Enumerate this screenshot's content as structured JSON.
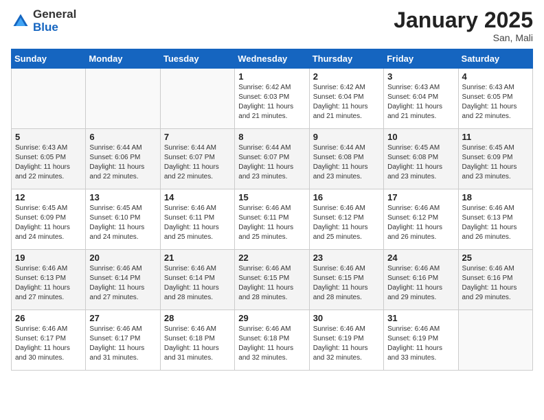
{
  "header": {
    "logo_general": "General",
    "logo_blue": "Blue",
    "month_title": "January 2025",
    "location": "San, Mali"
  },
  "days_of_week": [
    "Sunday",
    "Monday",
    "Tuesday",
    "Wednesday",
    "Thursday",
    "Friday",
    "Saturday"
  ],
  "weeks": [
    [
      {
        "day": "",
        "sunrise": "",
        "sunset": "",
        "daylight": "",
        "empty": true
      },
      {
        "day": "",
        "sunrise": "",
        "sunset": "",
        "daylight": "",
        "empty": true
      },
      {
        "day": "",
        "sunrise": "",
        "sunset": "",
        "daylight": "",
        "empty": true
      },
      {
        "day": "1",
        "sunrise": "Sunrise: 6:42 AM",
        "sunset": "Sunset: 6:03 PM",
        "daylight": "Daylight: 11 hours and 21 minutes.",
        "empty": false
      },
      {
        "day": "2",
        "sunrise": "Sunrise: 6:42 AM",
        "sunset": "Sunset: 6:04 PM",
        "daylight": "Daylight: 11 hours and 21 minutes.",
        "empty": false
      },
      {
        "day": "3",
        "sunrise": "Sunrise: 6:43 AM",
        "sunset": "Sunset: 6:04 PM",
        "daylight": "Daylight: 11 hours and 21 minutes.",
        "empty": false
      },
      {
        "day": "4",
        "sunrise": "Sunrise: 6:43 AM",
        "sunset": "Sunset: 6:05 PM",
        "daylight": "Daylight: 11 hours and 22 minutes.",
        "empty": false
      }
    ],
    [
      {
        "day": "5",
        "sunrise": "Sunrise: 6:43 AM",
        "sunset": "Sunset: 6:05 PM",
        "daylight": "Daylight: 11 hours and 22 minutes.",
        "empty": false
      },
      {
        "day": "6",
        "sunrise": "Sunrise: 6:44 AM",
        "sunset": "Sunset: 6:06 PM",
        "daylight": "Daylight: 11 hours and 22 minutes.",
        "empty": false
      },
      {
        "day": "7",
        "sunrise": "Sunrise: 6:44 AM",
        "sunset": "Sunset: 6:07 PM",
        "daylight": "Daylight: 11 hours and 22 minutes.",
        "empty": false
      },
      {
        "day": "8",
        "sunrise": "Sunrise: 6:44 AM",
        "sunset": "Sunset: 6:07 PM",
        "daylight": "Daylight: 11 hours and 23 minutes.",
        "empty": false
      },
      {
        "day": "9",
        "sunrise": "Sunrise: 6:44 AM",
        "sunset": "Sunset: 6:08 PM",
        "daylight": "Daylight: 11 hours and 23 minutes.",
        "empty": false
      },
      {
        "day": "10",
        "sunrise": "Sunrise: 6:45 AM",
        "sunset": "Sunset: 6:08 PM",
        "daylight": "Daylight: 11 hours and 23 minutes.",
        "empty": false
      },
      {
        "day": "11",
        "sunrise": "Sunrise: 6:45 AM",
        "sunset": "Sunset: 6:09 PM",
        "daylight": "Daylight: 11 hours and 23 minutes.",
        "empty": false
      }
    ],
    [
      {
        "day": "12",
        "sunrise": "Sunrise: 6:45 AM",
        "sunset": "Sunset: 6:09 PM",
        "daylight": "Daylight: 11 hours and 24 minutes.",
        "empty": false
      },
      {
        "day": "13",
        "sunrise": "Sunrise: 6:45 AM",
        "sunset": "Sunset: 6:10 PM",
        "daylight": "Daylight: 11 hours and 24 minutes.",
        "empty": false
      },
      {
        "day": "14",
        "sunrise": "Sunrise: 6:46 AM",
        "sunset": "Sunset: 6:11 PM",
        "daylight": "Daylight: 11 hours and 25 minutes.",
        "empty": false
      },
      {
        "day": "15",
        "sunrise": "Sunrise: 6:46 AM",
        "sunset": "Sunset: 6:11 PM",
        "daylight": "Daylight: 11 hours and 25 minutes.",
        "empty": false
      },
      {
        "day": "16",
        "sunrise": "Sunrise: 6:46 AM",
        "sunset": "Sunset: 6:12 PM",
        "daylight": "Daylight: 11 hours and 25 minutes.",
        "empty": false
      },
      {
        "day": "17",
        "sunrise": "Sunrise: 6:46 AM",
        "sunset": "Sunset: 6:12 PM",
        "daylight": "Daylight: 11 hours and 26 minutes.",
        "empty": false
      },
      {
        "day": "18",
        "sunrise": "Sunrise: 6:46 AM",
        "sunset": "Sunset: 6:13 PM",
        "daylight": "Daylight: 11 hours and 26 minutes.",
        "empty": false
      }
    ],
    [
      {
        "day": "19",
        "sunrise": "Sunrise: 6:46 AM",
        "sunset": "Sunset: 6:13 PM",
        "daylight": "Daylight: 11 hours and 27 minutes.",
        "empty": false
      },
      {
        "day": "20",
        "sunrise": "Sunrise: 6:46 AM",
        "sunset": "Sunset: 6:14 PM",
        "daylight": "Daylight: 11 hours and 27 minutes.",
        "empty": false
      },
      {
        "day": "21",
        "sunrise": "Sunrise: 6:46 AM",
        "sunset": "Sunset: 6:14 PM",
        "daylight": "Daylight: 11 hours and 28 minutes.",
        "empty": false
      },
      {
        "day": "22",
        "sunrise": "Sunrise: 6:46 AM",
        "sunset": "Sunset: 6:15 PM",
        "daylight": "Daylight: 11 hours and 28 minutes.",
        "empty": false
      },
      {
        "day": "23",
        "sunrise": "Sunrise: 6:46 AM",
        "sunset": "Sunset: 6:15 PM",
        "daylight": "Daylight: 11 hours and 28 minutes.",
        "empty": false
      },
      {
        "day": "24",
        "sunrise": "Sunrise: 6:46 AM",
        "sunset": "Sunset: 6:16 PM",
        "daylight": "Daylight: 11 hours and 29 minutes.",
        "empty": false
      },
      {
        "day": "25",
        "sunrise": "Sunrise: 6:46 AM",
        "sunset": "Sunset: 6:16 PM",
        "daylight": "Daylight: 11 hours and 29 minutes.",
        "empty": false
      }
    ],
    [
      {
        "day": "26",
        "sunrise": "Sunrise: 6:46 AM",
        "sunset": "Sunset: 6:17 PM",
        "daylight": "Daylight: 11 hours and 30 minutes.",
        "empty": false
      },
      {
        "day": "27",
        "sunrise": "Sunrise: 6:46 AM",
        "sunset": "Sunset: 6:17 PM",
        "daylight": "Daylight: 11 hours and 31 minutes.",
        "empty": false
      },
      {
        "day": "28",
        "sunrise": "Sunrise: 6:46 AM",
        "sunset": "Sunset: 6:18 PM",
        "daylight": "Daylight: 11 hours and 31 minutes.",
        "empty": false
      },
      {
        "day": "29",
        "sunrise": "Sunrise: 6:46 AM",
        "sunset": "Sunset: 6:18 PM",
        "daylight": "Daylight: 11 hours and 32 minutes.",
        "empty": false
      },
      {
        "day": "30",
        "sunrise": "Sunrise: 6:46 AM",
        "sunset": "Sunset: 6:19 PM",
        "daylight": "Daylight: 11 hours and 32 minutes.",
        "empty": false
      },
      {
        "day": "31",
        "sunrise": "Sunrise: 6:46 AM",
        "sunset": "Sunset: 6:19 PM",
        "daylight": "Daylight: 11 hours and 33 minutes.",
        "empty": false
      },
      {
        "day": "",
        "sunrise": "",
        "sunset": "",
        "daylight": "",
        "empty": true
      }
    ]
  ]
}
